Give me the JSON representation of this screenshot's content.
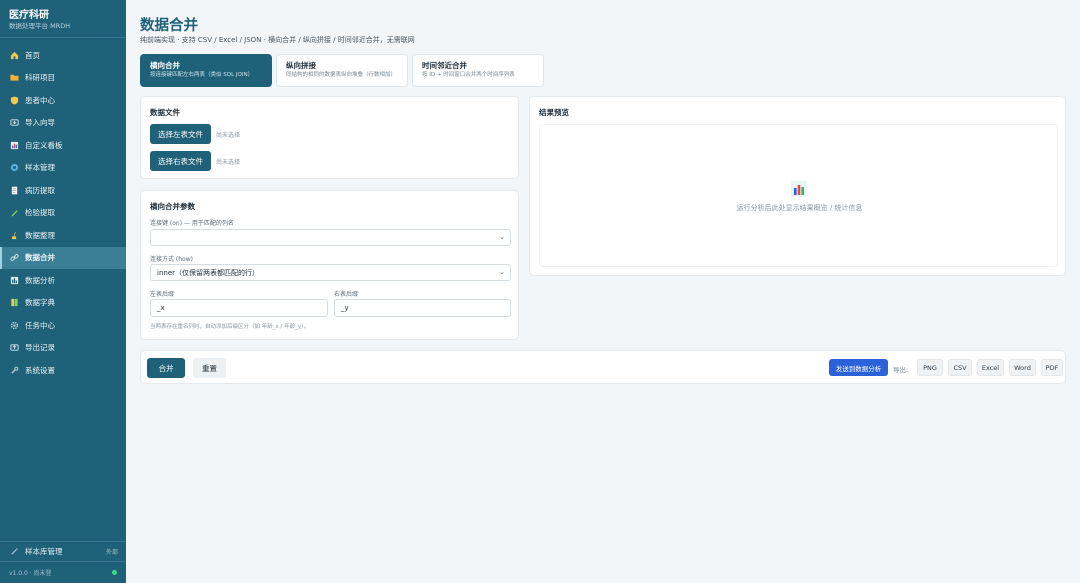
{
  "brand": {
    "title": "医疗科研",
    "subtitle": "数据处理平台 MRDH"
  },
  "nav": [
    {
      "label": "首页",
      "icon": "home-icon"
    },
    {
      "label": "科研项目",
      "icon": "folder-icon"
    },
    {
      "label": "患者中心",
      "icon": "shield-icon"
    },
    {
      "label": "导入向导",
      "icon": "import-icon"
    },
    {
      "label": "自定义看板",
      "icon": "dashboard-icon"
    },
    {
      "label": "样本管理",
      "icon": "sample-icon"
    },
    {
      "label": "病历提取",
      "icon": "document-icon"
    },
    {
      "label": "检验提取",
      "icon": "pen-icon"
    },
    {
      "label": "数据整理",
      "icon": "broom-icon"
    },
    {
      "label": "数据合并",
      "icon": "link-icon",
      "active": true
    },
    {
      "label": "数据分析",
      "icon": "chart-icon"
    },
    {
      "label": "数据字典",
      "icon": "book-icon"
    },
    {
      "label": "任务中心",
      "icon": "gear-icon"
    },
    {
      "label": "导出记录",
      "icon": "export-icon"
    },
    {
      "label": "系统设置",
      "icon": "wrench-icon"
    }
  ],
  "sidebar_bottom": {
    "library_label": "样本库管理",
    "library_expand": "外部",
    "version": "v1.0.0 · 尚未登"
  },
  "header": {
    "title": "数据合并",
    "subtitle": "纯前端实现 · 支持 CSV / Excel / JSON · 横向合并 / 纵向拼接 / 时间邻近合并，无需联网"
  },
  "tabs": [
    {
      "title": "横向合并",
      "desc": "按连接键匹配左右两表（类似 SQL JOIN）",
      "active": true
    },
    {
      "title": "纵向拼接",
      "desc": "同结构的相同的数据表纵向堆叠（行数相加）"
    },
    {
      "title": "时间邻近合并",
      "desc": "按 ID + 时间窗口合并两个时间序列表"
    }
  ],
  "files": {
    "title": "数据文件",
    "left_button": "选择左表文件",
    "left_status": "尚未选择",
    "right_button": "选择右表文件",
    "right_status": "尚未选择"
  },
  "params": {
    "title": "横向合并参数",
    "key_label": "连接键 (on) — 用于匹配的列名",
    "key_value": "",
    "how_label": "连接方式 (how)",
    "how_value": "inner（仅保留两表都匹配的行）",
    "left_suffix_label": "左表后缀",
    "left_suffix_value": "_x",
    "right_suffix_label": "右表后缀",
    "right_suffix_value": "_y",
    "hint": "当两表存在重名列时，自动添加后缀区分（如 年龄_x / 年龄_y）。"
  },
  "result": {
    "title": "结果预览",
    "placeholder": "运行分析后此处显示结果概览 / 统计信息",
    "icon": "bar-chart-icon"
  },
  "actions": {
    "merge": "合并",
    "reset": "重置",
    "send": "发送到数据分析",
    "export_label": "导出:",
    "exports": [
      "PNG",
      "CSV",
      "Excel",
      "Word",
      "PDF"
    ]
  }
}
